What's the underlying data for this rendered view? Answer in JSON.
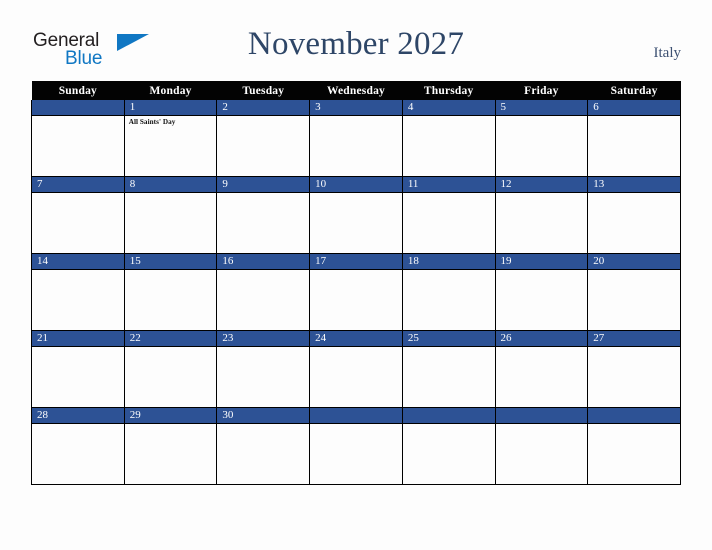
{
  "brand": {
    "name_part1": "General",
    "name_part2": "Blue",
    "triangle_icon": "triangle-logo-icon",
    "colors": {
      "dark_text": "#231f20",
      "blue": "#1077c3"
    }
  },
  "header": {
    "title": "November 2027",
    "country": "Italy",
    "title_color": "#2e4667",
    "country_color": "#3d5172"
  },
  "calendar": {
    "month": "November",
    "year": "2027",
    "weekday_headers": [
      "Sunday",
      "Monday",
      "Tuesday",
      "Wednesday",
      "Thursday",
      "Friday",
      "Saturday"
    ],
    "colors": {
      "header_background": "#030303",
      "header_text": "#ffffff",
      "daynum_band": "#2d5295",
      "daynum_text": "#ffffff",
      "cell_background": "#fdfdfd",
      "grid_line": "#000000"
    },
    "weeks": [
      [
        {
          "day": "",
          "events": []
        },
        {
          "day": "1",
          "events": [
            "All Saints' Day"
          ]
        },
        {
          "day": "2",
          "events": []
        },
        {
          "day": "3",
          "events": []
        },
        {
          "day": "4",
          "events": []
        },
        {
          "day": "5",
          "events": []
        },
        {
          "day": "6",
          "events": []
        }
      ],
      [
        {
          "day": "7",
          "events": []
        },
        {
          "day": "8",
          "events": []
        },
        {
          "day": "9",
          "events": []
        },
        {
          "day": "10",
          "events": []
        },
        {
          "day": "11",
          "events": []
        },
        {
          "day": "12",
          "events": []
        },
        {
          "day": "13",
          "events": []
        }
      ],
      [
        {
          "day": "14",
          "events": []
        },
        {
          "day": "15",
          "events": []
        },
        {
          "day": "16",
          "events": []
        },
        {
          "day": "17",
          "events": []
        },
        {
          "day": "18",
          "events": []
        },
        {
          "day": "19",
          "events": []
        },
        {
          "day": "20",
          "events": []
        }
      ],
      [
        {
          "day": "21",
          "events": []
        },
        {
          "day": "22",
          "events": []
        },
        {
          "day": "23",
          "events": []
        },
        {
          "day": "24",
          "events": []
        },
        {
          "day": "25",
          "events": []
        },
        {
          "day": "26",
          "events": []
        },
        {
          "day": "27",
          "events": []
        }
      ],
      [
        {
          "day": "28",
          "events": []
        },
        {
          "day": "29",
          "events": []
        },
        {
          "day": "30",
          "events": []
        },
        {
          "day": "",
          "events": []
        },
        {
          "day": "",
          "events": []
        },
        {
          "day": "",
          "events": []
        },
        {
          "day": "",
          "events": []
        }
      ]
    ]
  }
}
